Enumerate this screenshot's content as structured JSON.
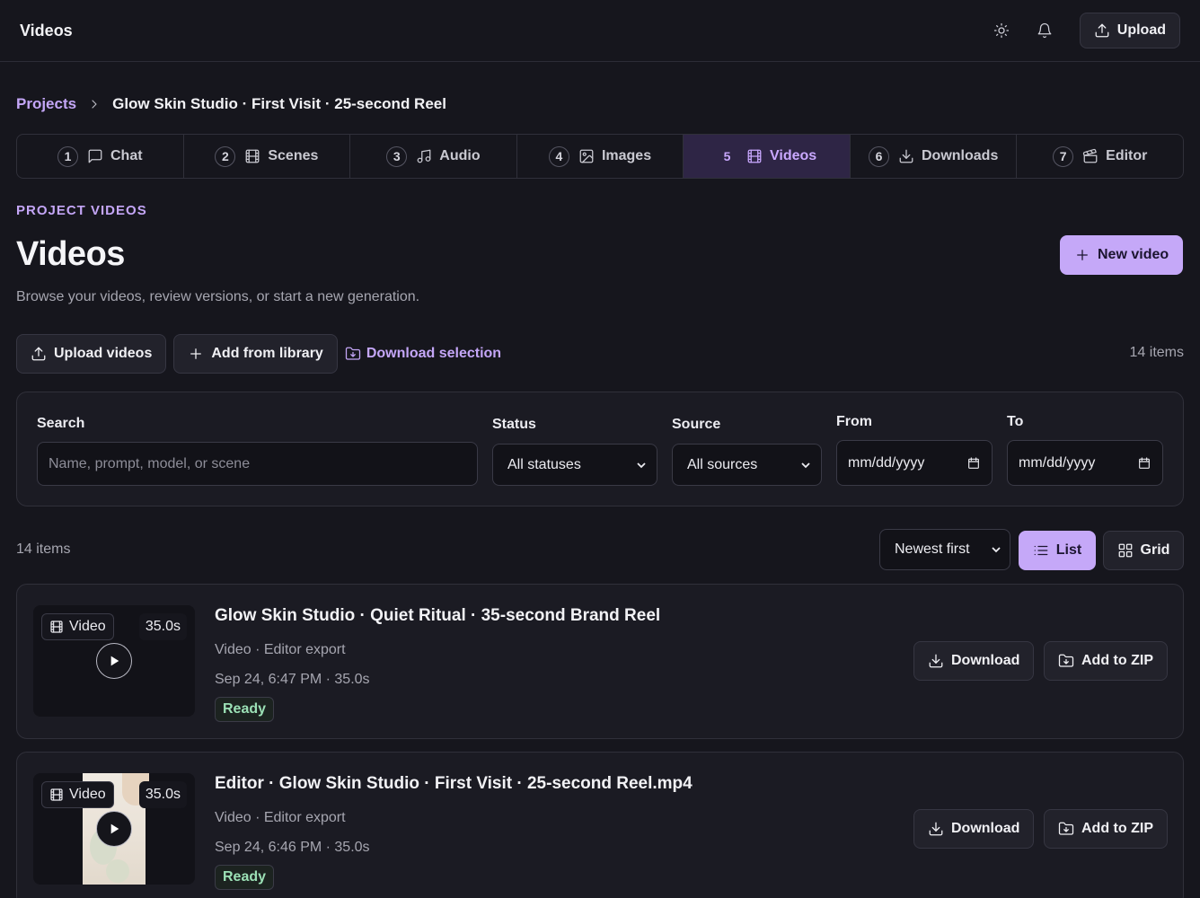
{
  "header": {
    "title": "Videos",
    "upload_label": "Upload"
  },
  "breadcrumb": {
    "root": "Projects",
    "current": "Glow Skin Studio · First Visit · 25-second Reel"
  },
  "steps": [
    {
      "num": "1",
      "label": "Chat",
      "icon": "chat-icon"
    },
    {
      "num": "2",
      "label": "Scenes",
      "icon": "film-icon"
    },
    {
      "num": "3",
      "label": "Audio",
      "icon": "music-icon"
    },
    {
      "num": "4",
      "label": "Images",
      "icon": "image-icon"
    },
    {
      "num": "5",
      "label": "Videos",
      "icon": "film-icon",
      "active": true
    },
    {
      "num": "6",
      "label": "Downloads",
      "icon": "download-icon"
    },
    {
      "num": "7",
      "label": "Editor",
      "icon": "clapper-icon"
    }
  ],
  "page": {
    "kicker": "PROJECT VIDEOS",
    "title": "Videos",
    "subtitle": "Browse your videos, review versions, or start a new generation.",
    "new_video_label": "New video"
  },
  "actions": {
    "upload_videos": "Upload videos",
    "add_from_library": "Add from library",
    "download_selection": "Download selection",
    "count": "14 items"
  },
  "filters": {
    "search_label": "Search",
    "search_placeholder": "Name, prompt, model, or scene",
    "status_label": "Status",
    "status_value": "All statuses",
    "source_label": "Source",
    "source_value": "All sources",
    "from_label": "From",
    "from_value": "mm/dd/yyyy",
    "to_label": "To",
    "to_value": "mm/dd/yyyy"
  },
  "list": {
    "count": "14 items",
    "sort_value": "Newest first",
    "view_list": "List",
    "view_grid": "Grid"
  },
  "videos": [
    {
      "tag": "Video",
      "duration": "35.0s",
      "title": "Glow Skin Studio · Quiet Ritual · 35-second Brand Reel",
      "meta": "Video · Editor export",
      "date": "Sep 24, 6:47 PM · 35.0s",
      "status": "Ready",
      "download_label": "Download",
      "zip_label": "Add to ZIP"
    },
    {
      "tag": "Video",
      "duration": "35.0s",
      "title": "Editor · Glow Skin Studio · First Visit · 25-second Reel.mp4",
      "meta": "Video · Editor export",
      "date": "Sep 24, 6:46 PM · 35.0s",
      "status": "Ready",
      "download_label": "Download",
      "zip_label": "Add to ZIP"
    }
  ],
  "colors": {
    "accent": "#c5a8f8",
    "ready": "#9be0b5",
    "background": "#16161d"
  }
}
